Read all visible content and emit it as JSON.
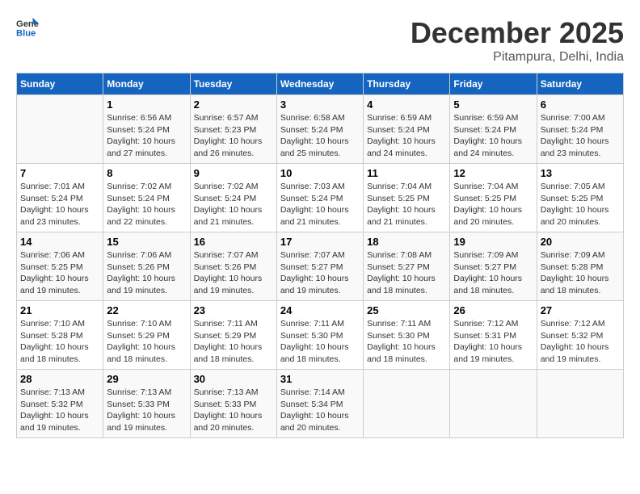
{
  "header": {
    "logo": {
      "general": "General",
      "blue": "Blue"
    },
    "title": "December 2025",
    "location": "Pitampura, Delhi, India"
  },
  "weekdays": [
    "Sunday",
    "Monday",
    "Tuesday",
    "Wednesday",
    "Thursday",
    "Friday",
    "Saturday"
  ],
  "weeks": [
    [
      null,
      {
        "day": 1,
        "sunrise": "6:56 AM",
        "sunset": "5:24 PM",
        "daylight": "10 hours and 27 minutes."
      },
      {
        "day": 2,
        "sunrise": "6:57 AM",
        "sunset": "5:23 PM",
        "daylight": "10 hours and 26 minutes."
      },
      {
        "day": 3,
        "sunrise": "6:58 AM",
        "sunset": "5:24 PM",
        "daylight": "10 hours and 25 minutes."
      },
      {
        "day": 4,
        "sunrise": "6:59 AM",
        "sunset": "5:24 PM",
        "daylight": "10 hours and 24 minutes."
      },
      {
        "day": 5,
        "sunrise": "6:59 AM",
        "sunset": "5:24 PM",
        "daylight": "10 hours and 24 minutes."
      },
      {
        "day": 6,
        "sunrise": "7:00 AM",
        "sunset": "5:24 PM",
        "daylight": "10 hours and 23 minutes."
      }
    ],
    [
      {
        "day": 7,
        "sunrise": "7:01 AM",
        "sunset": "5:24 PM",
        "daylight": "10 hours and 23 minutes."
      },
      {
        "day": 8,
        "sunrise": "7:02 AM",
        "sunset": "5:24 PM",
        "daylight": "10 hours and 22 minutes."
      },
      {
        "day": 9,
        "sunrise": "7:02 AM",
        "sunset": "5:24 PM",
        "daylight": "10 hours and 21 minutes."
      },
      {
        "day": 10,
        "sunrise": "7:03 AM",
        "sunset": "5:24 PM",
        "daylight": "10 hours and 21 minutes."
      },
      {
        "day": 11,
        "sunrise": "7:04 AM",
        "sunset": "5:25 PM",
        "daylight": "10 hours and 21 minutes."
      },
      {
        "day": 12,
        "sunrise": "7:04 AM",
        "sunset": "5:25 PM",
        "daylight": "10 hours and 20 minutes."
      },
      {
        "day": 13,
        "sunrise": "7:05 AM",
        "sunset": "5:25 PM",
        "daylight": "10 hours and 20 minutes."
      }
    ],
    [
      {
        "day": 14,
        "sunrise": "7:06 AM",
        "sunset": "5:25 PM",
        "daylight": "10 hours and 19 minutes."
      },
      {
        "day": 15,
        "sunrise": "7:06 AM",
        "sunset": "5:26 PM",
        "daylight": "10 hours and 19 minutes."
      },
      {
        "day": 16,
        "sunrise": "7:07 AM",
        "sunset": "5:26 PM",
        "daylight": "10 hours and 19 minutes."
      },
      {
        "day": 17,
        "sunrise": "7:07 AM",
        "sunset": "5:27 PM",
        "daylight": "10 hours and 19 minutes."
      },
      {
        "day": 18,
        "sunrise": "7:08 AM",
        "sunset": "5:27 PM",
        "daylight": "10 hours and 18 minutes."
      },
      {
        "day": 19,
        "sunrise": "7:09 AM",
        "sunset": "5:27 PM",
        "daylight": "10 hours and 18 minutes."
      },
      {
        "day": 20,
        "sunrise": "7:09 AM",
        "sunset": "5:28 PM",
        "daylight": "10 hours and 18 minutes."
      }
    ],
    [
      {
        "day": 21,
        "sunrise": "7:10 AM",
        "sunset": "5:28 PM",
        "daylight": "10 hours and 18 minutes."
      },
      {
        "day": 22,
        "sunrise": "7:10 AM",
        "sunset": "5:29 PM",
        "daylight": "10 hours and 18 minutes."
      },
      {
        "day": 23,
        "sunrise": "7:11 AM",
        "sunset": "5:29 PM",
        "daylight": "10 hours and 18 minutes."
      },
      {
        "day": 24,
        "sunrise": "7:11 AM",
        "sunset": "5:30 PM",
        "daylight": "10 hours and 18 minutes."
      },
      {
        "day": 25,
        "sunrise": "7:11 AM",
        "sunset": "5:30 PM",
        "daylight": "10 hours and 18 minutes."
      },
      {
        "day": 26,
        "sunrise": "7:12 AM",
        "sunset": "5:31 PM",
        "daylight": "10 hours and 19 minutes."
      },
      {
        "day": 27,
        "sunrise": "7:12 AM",
        "sunset": "5:32 PM",
        "daylight": "10 hours and 19 minutes."
      }
    ],
    [
      {
        "day": 28,
        "sunrise": "7:13 AM",
        "sunset": "5:32 PM",
        "daylight": "10 hours and 19 minutes."
      },
      {
        "day": 29,
        "sunrise": "7:13 AM",
        "sunset": "5:33 PM",
        "daylight": "10 hours and 19 minutes."
      },
      {
        "day": 30,
        "sunrise": "7:13 AM",
        "sunset": "5:33 PM",
        "daylight": "10 hours and 20 minutes."
      },
      {
        "day": 31,
        "sunrise": "7:14 AM",
        "sunset": "5:34 PM",
        "daylight": "10 hours and 20 minutes."
      },
      null,
      null,
      null
    ]
  ],
  "labels": {
    "sunrise": "Sunrise:",
    "sunset": "Sunset:",
    "daylight": "Daylight:"
  }
}
